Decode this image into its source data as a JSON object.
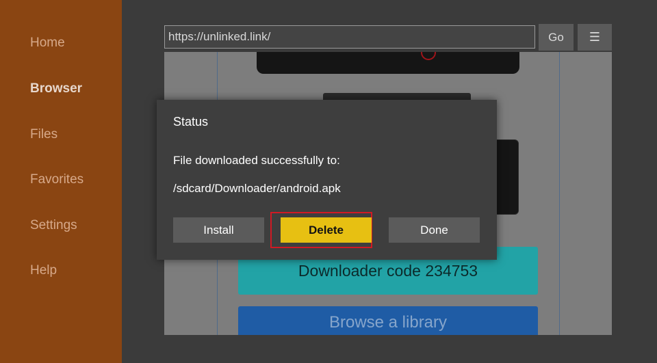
{
  "sidebar": {
    "items": [
      {
        "label": "Home",
        "active": false
      },
      {
        "label": "Browser",
        "active": true
      },
      {
        "label": "Files",
        "active": false
      },
      {
        "label": "Favorites",
        "active": false
      },
      {
        "label": "Settings",
        "active": false
      },
      {
        "label": "Help",
        "active": false
      }
    ]
  },
  "toolbar": {
    "url": "https://unlinked.link/",
    "go_label": "Go",
    "menu_icon": "☰"
  },
  "webpage": {
    "teal_button": "Downloader code 234753",
    "blue_button": "Browse a library"
  },
  "dialog": {
    "title": "Status",
    "message": "File downloaded successfully to:",
    "path": "/sdcard/Downloader/android.apk",
    "buttons": {
      "install": "Install",
      "delete": "Delete",
      "done": "Done"
    }
  },
  "colors": {
    "sidebar_bg": "#8a4512",
    "delete_button": "#e7c012",
    "highlight": "#d11a24",
    "teal_button": "#22a3a6",
    "blue_button": "#1f5ca5"
  }
}
